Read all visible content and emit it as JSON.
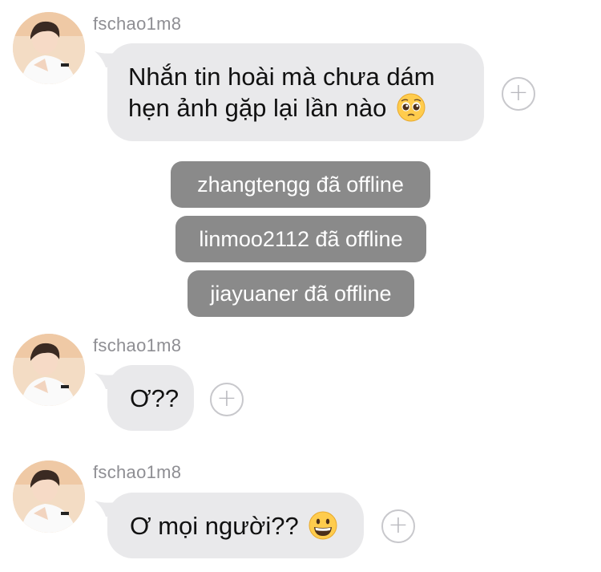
{
  "messages": [
    {
      "username": "fschao1m8",
      "text_line1": "Nhắn tin hoài mà chưa dám",
      "text_line2": "hẹn ảnh gặp lại lần nào",
      "emoji": "pleading-face-emoji"
    },
    {
      "username": "fschao1m8",
      "text": "Ơ??"
    },
    {
      "username": "fschao1m8",
      "text": "Ơ mọi người??",
      "emoji": "grinning-face-emoji"
    }
  ],
  "system_notices": [
    "zhangtengg đã offline",
    "linmoo2112 đã offline",
    "jiayuaner đã offline"
  ],
  "plus_label": "+",
  "colors": {
    "bubble": "#e9e9eb",
    "notice": "#8a8a8a",
    "username": "#8e8e93"
  }
}
